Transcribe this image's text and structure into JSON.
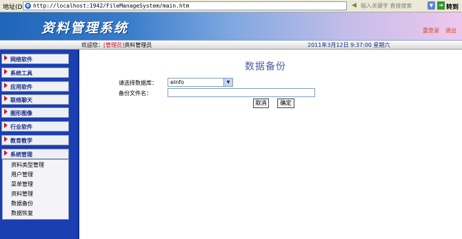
{
  "addressbar": {
    "label": "地址(D)",
    "url": "http://localhost:1942/FileManageSystem/main.htm",
    "search_placeholder": "输入关键字 直接搜索",
    "go_label": "转到"
  },
  "header": {
    "logo_text": "资料管理系统",
    "relogin": "重登录",
    "logout": "退出"
  },
  "welcome": {
    "prefix": "欢迎您：",
    "role": "[管理员]",
    "user": "资料管理员",
    "datetime": "2011年3月12日  9:37:00  星期六"
  },
  "sidebar": {
    "menus": [
      {
        "label": "网络软件"
      },
      {
        "label": "系统工具"
      },
      {
        "label": "应用软件"
      },
      {
        "label": "联络聊天"
      },
      {
        "label": "图形图像"
      },
      {
        "label": "行业软件"
      },
      {
        "label": "教育教学"
      },
      {
        "label": "系统管理"
      }
    ],
    "submenu": [
      {
        "label": "资料类型管理"
      },
      {
        "label": "用户管理"
      },
      {
        "label": "菜单管理"
      },
      {
        "label": "资料管理"
      },
      {
        "label": "数据备份"
      },
      {
        "label": "数据恢复"
      }
    ]
  },
  "main": {
    "title": "数据备份",
    "db_label": "请选择数据库：",
    "db_value": "eInfo",
    "filename_label": "备份文件名：",
    "filename_value": "",
    "cancel_label": "取消",
    "ok_label": "确定"
  }
}
